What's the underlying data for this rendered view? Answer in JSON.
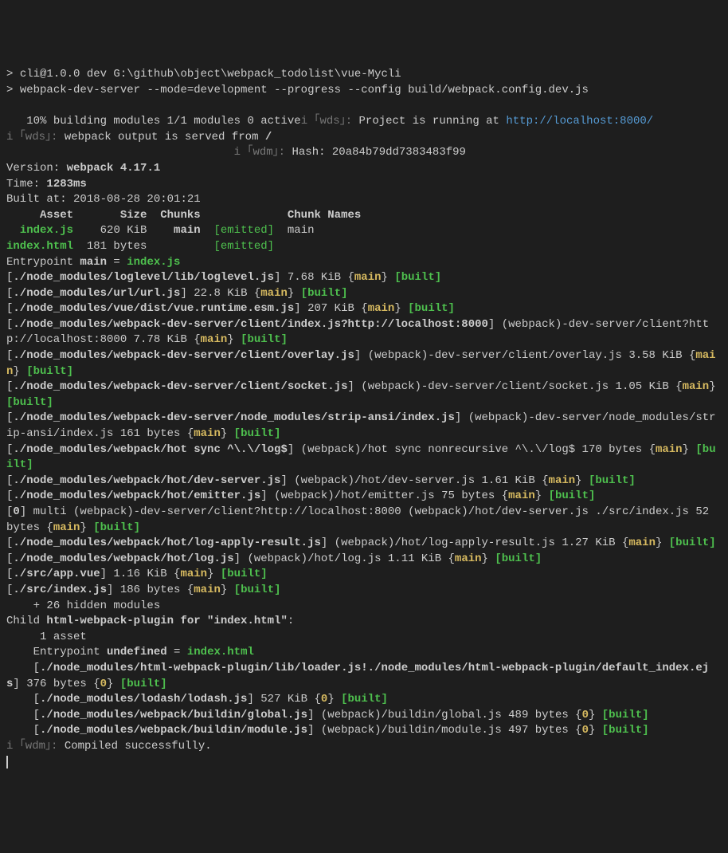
{
  "cmd1_prompt": "> ",
  "cmd1": "cli@1.0.0 dev G:\\github\\object\\webpack_todolist\\vue-Mycli",
  "cmd2_prompt": "> ",
  "cmd2": "webpack-dev-server --mode=development --progress --config build/webpack.config.dev.js",
  "progress": "   10% building modules 1/1 modules 0 active",
  "wds_i": "i",
  "wds_tag": " ｢wds｣: ",
  "wds_proj": "Project is running at ",
  "wds_url": "http://localhost:8000/",
  "wds_served": "webpack output is served from ",
  "wds_slash": "/",
  "wdm_tag": " ｢wdm｣: ",
  "hash": "Hash: 20a84b79dd7383483f99",
  "version_label": "Version: ",
  "version": "webpack 4.17.1",
  "time_label": "Time: ",
  "time": "1283ms",
  "built_at_label": "Built at: ",
  "built_at": "2018-08-28 20:01:21",
  "hdr_asset": "     Asset       Size  Chunks             Chunk Names",
  "row1_asset": "  index.js",
  "row1_size": "    620 KiB",
  "row1_chunk": "    main",
  "row1_emitted": "  [emitted]",
  "row1_name": "  main",
  "row2_asset": "index.html",
  "row2_size": "  181 bytes",
  "row2_chunk": "        ",
  "row2_emitted": "  [emitted]",
  "entrypoint_label": "Entrypoint ",
  "entrypoint_main": "main",
  "entrypoint_eq": " = ",
  "entrypoint_file": "index.js",
  "m1_path": "./node_modules/loglevel/lib/loglevel.js",
  "m1_size": " 7.68 KiB ",
  "m2_path": "./node_modules/url/url.js",
  "m2_size": " 22.8 KiB ",
  "m3_path": "./node_modules/vue/dist/vue.runtime.esm.js",
  "m3_size": " 207 KiB ",
  "m4_path": "./node_modules/webpack-dev-server/client/index.js?http://localhost:8000",
  "m4_alias": " (webpack)-dev-server/client?http://localhost:8000",
  "m4_size": " 7.78 KiB ",
  "m5_path": "./node_modules/webpack-dev-server/client/overlay.js",
  "m5_alias": " (webpack)-dev-server/client/overlay.js",
  "m5_size": " 3.58 KiB ",
  "m6_path": "./node_modules/webpack-dev-server/client/socket.js",
  "m6_alias": " (webpack)-dev-server/client/socket.js",
  "m6_size": " 1.05 KiB ",
  "m7_path": "./node_modules/webpack-dev-server/node_modules/strip-ansi/index.js",
  "m7_alias": " (webpack)-dev-server/node_modules/strip-ansi/index.js",
  "m7_size": " 161 bytes ",
  "m8_path": "./node_modules/webpack/hot sync ^\\.\\/log$",
  "m8_alias": " (webpack)/hot sync nonrecursive ^\\.\\/log$",
  "m8_size": " 170 bytes ",
  "m9_path": "./node_modules/webpack/hot/dev-server.js",
  "m9_alias": " (webpack)/hot/dev-server.js",
  "m9_size": " 1.61 KiB ",
  "m10_path": "./node_modules/webpack/hot/emitter.js",
  "m10_alias": " (webpack)/hot/emitter.js",
  "m10_size": " 75 bytes ",
  "m11_label": "0",
  "m11_text": " multi (webpack)-dev-server/client?http://localhost:8000 (webpack)/hot/dev-server.js ./src/index.js",
  "m11_size": " 52 bytes ",
  "m12_path": "./node_modules/webpack/hot/log-apply-result.js",
  "m12_alias": " (webpack)/hot/log-apply-result.js",
  "m12_size": " 1.27 KiB ",
  "m13_path": "./node_modules/webpack/hot/log.js",
  "m13_alias": " (webpack)/hot/log.js",
  "m13_size": " 1.11 KiB ",
  "m14_path": "./src/app.vue",
  "m14_size": " 1.16 KiB ",
  "m15_path": "./src/index.js",
  "m15_size": " 186 bytes ",
  "hidden": "    + 26 hidden modules",
  "child_label": "Child ",
  "child_name": "html-webpack-plugin for \"index.html\"",
  "child_colon": ":",
  "child_asset_count": "     1 asset",
  "child_entry_label": "    Entrypoint ",
  "child_entry_name": "undefined",
  "child_entry_eq": " = ",
  "child_entry_file": "index.html",
  "c1_path": "./node_modules/html-webpack-plugin/lib/loader.js!./node_modules/html-webpack-plugin/default_index.ejs",
  "c1_size": " 376 bytes ",
  "c2_path": "./node_modules/lodash/lodash.js",
  "c2_size": " 527 KiB ",
  "c3_path": "./node_modules/webpack/buildin/global.js",
  "c3_alias": " (webpack)/buildin/global.js",
  "c3_size": " 489 bytes ",
  "c4_path": "./node_modules/webpack/buildin/module.js",
  "c4_alias": " (webpack)/buildin/module.js",
  "c4_size": " 497 bytes ",
  "compiled": "Compiled successfully.",
  "chunk_main": "main",
  "chunk_main_brace_open": "{",
  "chunk_main_brace_close": "}",
  "chunk_0": "0",
  "built_token": "[built]",
  "open_br": "[",
  "close_br": "]",
  "indent4": "    "
}
